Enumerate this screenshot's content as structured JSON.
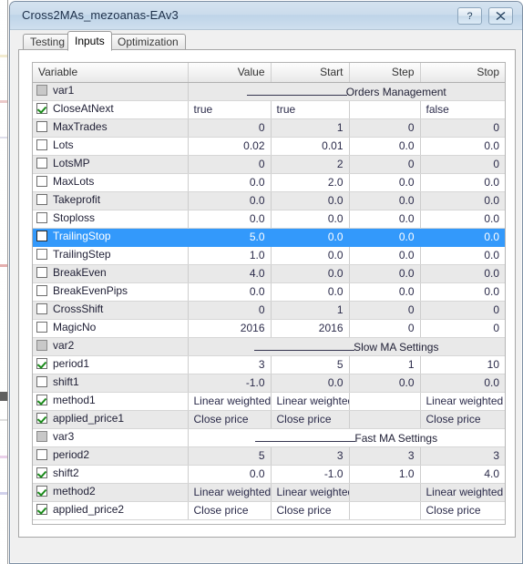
{
  "window": {
    "title": "Cross2MAs_mezoanas-EAv3",
    "help_button": "?",
    "close_button": "✕"
  },
  "tabs": [
    {
      "label": "Testing",
      "active": false
    },
    {
      "label": "Inputs",
      "active": true
    },
    {
      "label": "Optimization",
      "active": false
    }
  ],
  "grid": {
    "columns": [
      "Variable",
      "Value",
      "Start",
      "Step",
      "Stop"
    ],
    "rows": [
      {
        "name": "var1",
        "checkbox": "disabled",
        "separator": true,
        "separator_label": "Orders Management",
        "value": "",
        "start": "",
        "step": "",
        "stop": ""
      },
      {
        "name": "CloseAtNext",
        "checkbox": "checked",
        "separator": false,
        "value": "true",
        "start": "true",
        "step": "",
        "stop": "false",
        "align": "left"
      },
      {
        "name": "MaxTrades",
        "checkbox": "unchecked",
        "separator": false,
        "value": "0",
        "start": "1",
        "step": "0",
        "stop": "0"
      },
      {
        "name": "Lots",
        "checkbox": "unchecked",
        "separator": false,
        "value": "0.02",
        "start": "0.01",
        "step": "0.0",
        "stop": "0.0"
      },
      {
        "name": "LotsMP",
        "checkbox": "unchecked",
        "separator": false,
        "value": "0",
        "start": "2",
        "step": "0",
        "stop": "0"
      },
      {
        "name": "MaxLots",
        "checkbox": "unchecked",
        "separator": false,
        "value": "0.0",
        "start": "2.0",
        "step": "0.0",
        "stop": "0.0"
      },
      {
        "name": "Takeprofit",
        "checkbox": "unchecked",
        "separator": false,
        "value": "0.0",
        "start": "0.0",
        "step": "0.0",
        "stop": "0.0"
      },
      {
        "name": "Stoploss",
        "checkbox": "unchecked",
        "separator": false,
        "value": "0.0",
        "start": "0.0",
        "step": "0.0",
        "stop": "0.0"
      },
      {
        "name": "TrailingStop",
        "checkbox": "unchecked",
        "separator": false,
        "selected": true,
        "value": "5.0",
        "start": "0.0",
        "step": "0.0",
        "stop": "0.0"
      },
      {
        "name": "TrailingStep",
        "checkbox": "unchecked",
        "separator": false,
        "value": "1.0",
        "start": "0.0",
        "step": "0.0",
        "stop": "0.0"
      },
      {
        "name": "BreakEven",
        "checkbox": "unchecked",
        "separator": false,
        "value": "4.0",
        "start": "0.0",
        "step": "0.0",
        "stop": "0.0"
      },
      {
        "name": "BreakEvenPips",
        "checkbox": "unchecked",
        "separator": false,
        "value": "0.0",
        "start": "0.0",
        "step": "0.0",
        "stop": "0.0"
      },
      {
        "name": "CrossShift",
        "checkbox": "unchecked",
        "separator": false,
        "value": "0",
        "start": "1",
        "step": "0",
        "stop": "0"
      },
      {
        "name": "MagicNo",
        "checkbox": "unchecked",
        "separator": false,
        "value": "2016",
        "start": "2016",
        "step": "0",
        "stop": "0"
      },
      {
        "name": "var2",
        "checkbox": "disabled",
        "separator": true,
        "separator_label": "Slow MA Settings",
        "value": "",
        "start": "",
        "step": "",
        "stop": ""
      },
      {
        "name": "period1",
        "checkbox": "checked",
        "separator": false,
        "value": "3",
        "start": "5",
        "step": "1",
        "stop": "10"
      },
      {
        "name": "shift1",
        "checkbox": "unchecked",
        "separator": false,
        "value": "-1.0",
        "start": "0.0",
        "step": "0.0",
        "stop": "0.0"
      },
      {
        "name": "method1",
        "checkbox": "checked",
        "separator": false,
        "value": "Linear weighted",
        "start": "Linear weighted",
        "step": "",
        "stop": "Linear weighted",
        "align": "left"
      },
      {
        "name": "applied_price1",
        "checkbox": "checked",
        "separator": false,
        "value": "Close price",
        "start": "Close price",
        "step": "",
        "stop": "Close price",
        "align": "left"
      },
      {
        "name": "var3",
        "checkbox": "disabled",
        "separator": true,
        "separator_label": "Fast MA Settings",
        "value": "",
        "start": "",
        "step": "",
        "stop": ""
      },
      {
        "name": "period2",
        "checkbox": "unchecked",
        "separator": false,
        "value": "5",
        "start": "3",
        "step": "3",
        "stop": "3"
      },
      {
        "name": "shift2",
        "checkbox": "checked",
        "separator": false,
        "value": "0.0",
        "start": "-1.0",
        "step": "1.0",
        "stop": "4.0"
      },
      {
        "name": "method2",
        "checkbox": "checked",
        "separator": false,
        "value": "Linear weighted",
        "start": "Linear weighted",
        "step": "",
        "stop": "Linear weighted",
        "align": "left"
      },
      {
        "name": "applied_price2",
        "checkbox": "checked",
        "separator": false,
        "value": "Close price",
        "start": "Close price",
        "step": "",
        "stop": "Close price",
        "align": "left"
      }
    ]
  },
  "colors": {
    "selection": "#3399fb",
    "alt_row": "#e9e9e9",
    "titlebar": "#cbdcec",
    "check_green": "#1a8a1a"
  }
}
